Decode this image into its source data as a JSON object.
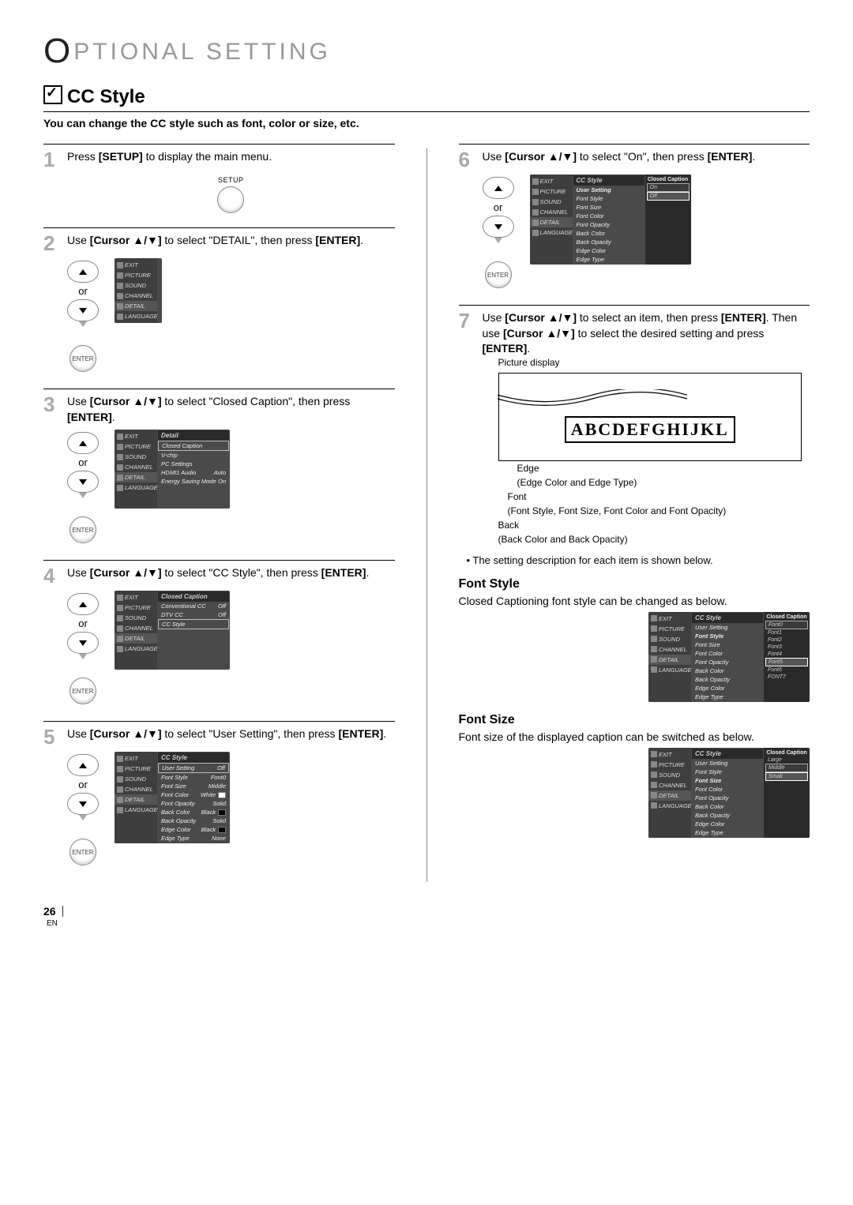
{
  "header": {
    "title_main": "PTIONAL  SETTING",
    "title_cap": "O"
  },
  "section": {
    "title": "CC Style",
    "sub": "You can change the CC style such as font, color or size, etc."
  },
  "remote": {
    "setup": "SETUP",
    "enter": "ENTER",
    "or": "or"
  },
  "menu": {
    "exit": "EXIT",
    "picture": "PICTURE",
    "sound": "SOUND",
    "channel": "CHANNEL",
    "detail": "DETAIL",
    "language": "LANGUAGE"
  },
  "steps": {
    "s1": {
      "num": "1",
      "text": "Press [SETUP] to display the main menu."
    },
    "s2": {
      "num": "2",
      "text": "Use [Cursor ▲/▼] to select \"DETAIL\", then press [ENTER]."
    },
    "s3": {
      "num": "3",
      "text": "Use [Cursor ▲/▼] to select \"Closed Caption\", then press [ENTER]."
    },
    "s4": {
      "num": "4",
      "text": "Use [Cursor ▲/▼] to select \"CC Style\", then press [ENTER]."
    },
    "s5": {
      "num": "5",
      "text": "Use [Cursor ▲/▼] to select \"User Setting\", then press [ENTER]."
    },
    "s6": {
      "num": "6",
      "text": "Use [Cursor ▲/▼] to select \"On\", then press [ENTER]."
    },
    "s7a": {
      "num": "7",
      "text": "Use [Cursor ▲/▼] to select an item, then press [ENTER]. Then use [Cursor ▲/▼] to select the desired setting and press [ENTER]."
    }
  },
  "detail_menu": {
    "title": "Detail",
    "rows": {
      "r1": {
        "label": "Closed Caption",
        "val": ""
      },
      "r2": {
        "label": "V-chip",
        "val": ""
      },
      "r3": {
        "label": "PC Settings",
        "val": ""
      },
      "r4": {
        "label": "HDMI1 Audio",
        "val": "Auto"
      },
      "r5": {
        "label": "Energy Saving Mode",
        "val": "On"
      }
    }
  },
  "cc_menu": {
    "title": "Closed Caption",
    "rows": {
      "r1": {
        "label": "Conventional CC",
        "val": "Off"
      },
      "r2": {
        "label": "DTV CC",
        "val": "Off"
      },
      "r3": {
        "label": "CC Style",
        "val": ""
      }
    }
  },
  "style_menu": {
    "title": "CC Style",
    "rows": {
      "r1": {
        "label": "User Setting",
        "val": "Off"
      },
      "r2": {
        "label": "Font Style",
        "val": "Font0"
      },
      "r3": {
        "label": "Font Size",
        "val": "Middle"
      },
      "r4": {
        "label": "Font Color",
        "val": "White"
      },
      "r5": {
        "label": "Font Opacity",
        "val": "Solid"
      },
      "r6": {
        "label": "Back Color",
        "val": "Black"
      },
      "r7": {
        "label": "Back Opacity",
        "val": "Solid"
      },
      "r8": {
        "label": "Edge Color",
        "val": "Black"
      },
      "r9": {
        "label": "Edge Type",
        "val": "None"
      }
    }
  },
  "style_menu6": {
    "title": "CC Style",
    "vtitle": "Closed Caption",
    "rows": {
      "r1": "User Setting",
      "r2": "Font Style",
      "r3": "Font Size",
      "r4": "Font Color",
      "r5": "Font Opacity",
      "r6": "Back Color",
      "r7": "Back Opacity",
      "r8": "Edge Color",
      "r9": "Edge Type"
    },
    "vals": {
      "v1": "On",
      "v2": "Off"
    }
  },
  "fontstyle_menu": {
    "vtitle": "Closed Caption",
    "vals": {
      "v0": "Font0",
      "v1": "Font1",
      "v2": "Font2",
      "v3": "Font3",
      "v4": "Font4",
      "v5": "Font5",
      "v6": "Font6",
      "v7": "FONT7"
    }
  },
  "fontsize_menu": {
    "vtitle": "Closed Caption",
    "vals": {
      "v1": "Large",
      "v2": "Middle",
      "v3": "Small"
    }
  },
  "picture": {
    "caption": "Picture display",
    "sample": "ABCDEFGHIJKL",
    "edge_l": "Edge",
    "edge_d": "(Edge Color and Edge Type)",
    "font_l": "Font",
    "font_d": "(Font Style, Font Size, Font Color and Font Opacity)",
    "back_l": "Back",
    "back_d": "(Back Color and Back Opacity)"
  },
  "bullet1": "• The setting description for each item is shown below.",
  "fontstyle_h": "Font Style",
  "fontstyle_p": "Closed Captioning font style can be changed as below.",
  "fontsize_h": "Font Size",
  "fontsize_p": "Font size of the displayed caption can be switched as below.",
  "footer": {
    "page": "26",
    "lang": "EN"
  }
}
